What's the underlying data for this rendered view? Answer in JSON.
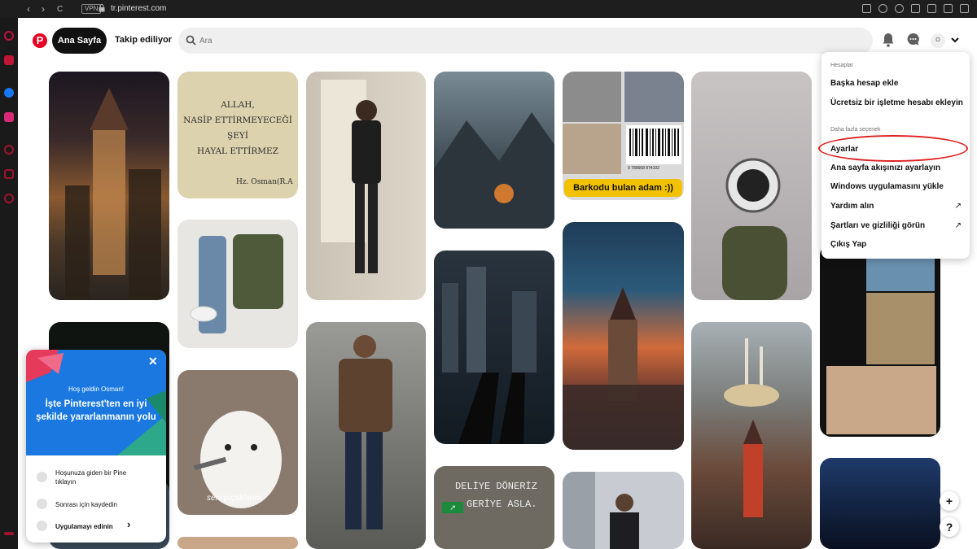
{
  "browser": {
    "back": "‹",
    "forward": "›",
    "reload": "C",
    "vpn": "VPN",
    "url": "tr.pinterest.com"
  },
  "header": {
    "logo": "P",
    "home_label": "Ana Sayfa",
    "following_label": "Takip ediliyor",
    "search_placeholder": "Ara",
    "avatar_letter": "O"
  },
  "pins": {
    "quote_lines": [
      "ALLAH,",
      "NASİP ETTİRMEYECEĞİ",
      "ŞEYİ",
      "HAYAL ETTİRMEZ"
    ],
    "quote_author": "Hz. Osman(R.A",
    "barcode_caption": "Barkodu bulan adam :))",
    "barcode_number": "9 789668 874102",
    "bear_caption": "seni pıçaklarım",
    "wall_text_lines": [
      "DELİYE DÖNERİZ",
      "GERİYE ASLA."
    ],
    "exit_sign": "↗"
  },
  "menu": {
    "section_accounts": "Hesaplar",
    "add_account": "Başka hesap ekle",
    "business_account": "Ücretsiz bir işletme hesabı ekleyin",
    "section_more": "Daha fazla seçenek",
    "settings": "Ayarlar",
    "tune_feed": "Ana sayfa akışınızı ayarlayın",
    "windows_app": "Windows uygulamasını yükle",
    "help": "Yardım alın",
    "terms": "Şartları ve gizliliği görün",
    "logout": "Çıkış Yap",
    "external_arrow": "↗"
  },
  "welcome": {
    "greeting": "Hoş geldin Osman!",
    "title": "İşte Pinterest'ten en iyi şekilde yararlanmanın yolu",
    "close": "✕",
    "steps": [
      "Hoşunuza giden bir Pine tıklayın",
      "Sonrası için kaydedin",
      "Uygulamayı edinin"
    ],
    "step_arrow": "›"
  },
  "fab": {
    "plus": "+",
    "help": "?"
  },
  "colors": {
    "brand": "#e60023",
    "highlight_oval": "#e02020",
    "welcome_blue": "#1a78e0"
  }
}
